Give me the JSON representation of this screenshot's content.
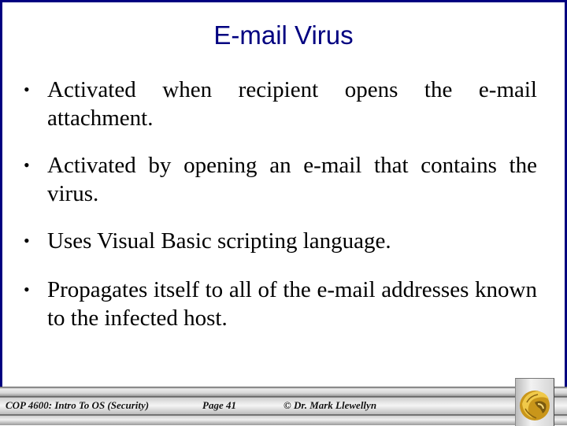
{
  "slide": {
    "title": "E-mail Virus",
    "bullet_glyph": "•",
    "bullets": [
      "Activated when recipient opens the e-mail attachment.",
      "Activated by opening an e-mail that contains the virus.",
      "Uses Visual Basic scripting language.",
      "Propagates itself to all of the e-mail addresses known to the infected host."
    ]
  },
  "footer": {
    "course": "COP 4600: Intro To OS  (Security)",
    "page": "Page 41",
    "author": "© Dr. Mark Llewellyn",
    "logo_icon": "pegasus-logo-icon"
  },
  "colors": {
    "border": "#000080",
    "title": "#000080",
    "logo_gold": "#d4a017"
  }
}
